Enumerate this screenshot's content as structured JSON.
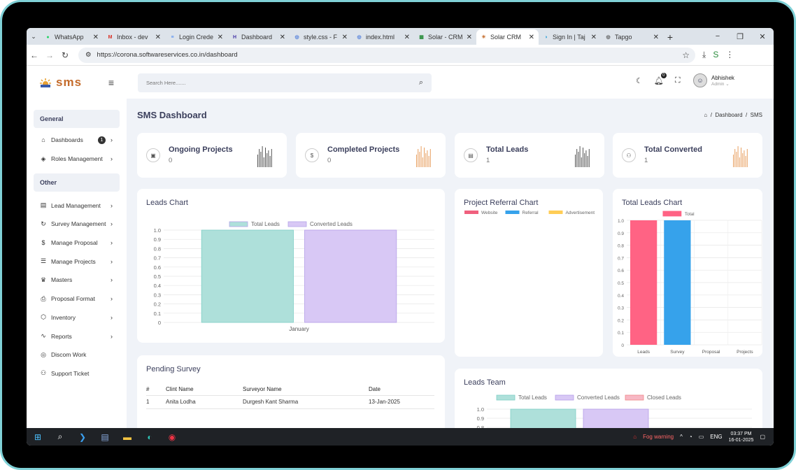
{
  "browser": {
    "tabs": [
      {
        "label": "WhatsApp",
        "fav": "whatsapp-icon",
        "color": "#25d366"
      },
      {
        "label": "Inbox - dev",
        "fav": "gmail-icon",
        "color": "#d93025"
      },
      {
        "label": "Login Crede",
        "fav": "docs-icon",
        "color": "#4285f4"
      },
      {
        "label": "Dashboard",
        "fav": "dashboard-icon",
        "color": "#4a3aa8"
      },
      {
        "label": "style.css - F",
        "fav": "globe-icon",
        "color": "#3b6fd8"
      },
      {
        "label": "index.html",
        "fav": "globe-icon",
        "color": "#3b6fd8"
      },
      {
        "label": "Solar - CRM",
        "fav": "solar-icon",
        "color": "#2a8c3c"
      },
      {
        "label": "Solar CRM",
        "fav": "solar-logo-icon",
        "color": "#c46b2b",
        "active": true
      },
      {
        "label": "Sign In | Taj",
        "fav": "signin-icon",
        "color": "#2a9fd8"
      },
      {
        "label": "Tapgo",
        "fav": "globe-icon",
        "color": "#444"
      }
    ],
    "url": "https://corona.softwareservices.co.in/dashboard"
  },
  "sidebar": {
    "logo": "sms",
    "general_label": "General",
    "general_items": [
      {
        "label": "Dashboards",
        "icon": "home-icon",
        "badge": "1"
      },
      {
        "label": "Roles Management",
        "icon": "cube-icon"
      }
    ],
    "other_label": "Other",
    "other_items": [
      {
        "label": "Lead Management",
        "icon": "file-icon",
        "chev": true
      },
      {
        "label": "Survey Management",
        "icon": "refresh-icon",
        "chev": true
      },
      {
        "label": "Manage Proposal",
        "icon": "dollar-icon",
        "chev": true
      },
      {
        "label": "Manage Projects",
        "icon": "server-icon",
        "chev": true
      },
      {
        "label": "Masters",
        "icon": "crown-icon",
        "chev": true
      },
      {
        "label": "Proposal Format",
        "icon": "printer-icon",
        "chev": true
      },
      {
        "label": "Inventory",
        "icon": "box-icon",
        "chev": true
      },
      {
        "label": "Reports",
        "icon": "activity-icon",
        "chev": true
      },
      {
        "label": "Discom Work",
        "icon": "target-icon",
        "chev": false
      },
      {
        "label": "Support Ticket",
        "icon": "users-icon",
        "chev": false
      }
    ]
  },
  "topbar": {
    "search_placeholder": "Search Here.......",
    "notif_count": "0",
    "user_name": "Abhishek",
    "user_role": "Admin"
  },
  "page": {
    "title": "SMS Dashboard",
    "crumb_1": "Dashboard",
    "crumb_2": "SMS"
  },
  "stats": [
    {
      "title": "Ongoing Projects",
      "value": "0",
      "icon": "calendar-icon",
      "bar_color": "#555"
    },
    {
      "title": "Completed Projects",
      "value": "0",
      "icon": "dollar-icon",
      "bar_color": "#e8a060"
    },
    {
      "title": "Total Leads",
      "value": "1",
      "icon": "file-icon",
      "bar_color": "#555"
    },
    {
      "title": "Total Converted",
      "value": "1",
      "icon": "users-icon",
      "bar_color": "#e8a060"
    }
  ],
  "charts": {
    "leads_title": "Leads Chart",
    "referral_title": "Project Referral Chart",
    "total_leads_title": "Total Leads Chart",
    "team_title": "Leads Team"
  },
  "chart_data": [
    {
      "type": "bar",
      "title": "Leads Chart",
      "categories": [
        "January"
      ],
      "series": [
        {
          "name": "Total Leads",
          "values": [
            1
          ],
          "color": "#aee0da"
        },
        {
          "name": "Converted Leads",
          "values": [
            1
          ],
          "color": "#d8c8f5"
        }
      ],
      "ylim": [
        0,
        1.0
      ],
      "yticks": [
        "0",
        "0.1",
        "0.2",
        "0.3",
        "0.4",
        "0.5",
        "0.6",
        "0.7",
        "0.8",
        "0.9",
        "1.0"
      ]
    },
    {
      "type": "pie",
      "title": "Project Referral Chart",
      "legend": [
        {
          "name": "Website",
          "color": "#f0607e"
        },
        {
          "name": "Referral",
          "color": "#36a2eb"
        },
        {
          "name": "Advertisement",
          "color": "#ffcd56"
        }
      ],
      "values": []
    },
    {
      "type": "bar",
      "title": "Total Leads Chart",
      "categories": [
        "Leads",
        "Survey",
        "Proposal",
        "Projects"
      ],
      "series": [
        {
          "name": "Total",
          "values": [
            1,
            1,
            0,
            0
          ],
          "colors": [
            "#ff6384",
            "#36a2eb",
            "#ffcd56",
            "#4bc0c0"
          ]
        }
      ],
      "ylim": [
        0,
        1.0
      ],
      "yticks": [
        "0",
        "0.1",
        "0.2",
        "0.3",
        "0.4",
        "0.5",
        "0.6",
        "0.7",
        "0.8",
        "0.9",
        "1.0"
      ]
    },
    {
      "type": "bar",
      "title": "Leads Team",
      "series": [
        {
          "name": "Total Leads",
          "values": [
            1
          ],
          "color": "#aee0da"
        },
        {
          "name": "Converted Leads",
          "values": [
            1
          ],
          "color": "#d8c8f5"
        },
        {
          "name": "Closed Leads",
          "values": [
            0
          ],
          "color": "#f7b8c4"
        }
      ],
      "ylim": [
        0,
        1.0
      ],
      "yticks": [
        "1.0",
        "0.9",
        "0.8"
      ]
    }
  ],
  "pending": {
    "title": "Pending Survey",
    "headers": [
      "#",
      "Clint Name",
      "Surveyor Name",
      "Date"
    ],
    "rows": [
      [
        "1",
        "Anita Lodha",
        "Durgesh Kant Sharma",
        "13-Jan-2025"
      ]
    ]
  },
  "taskbar": {
    "weather": "Fog warning",
    "lang": "ENG",
    "time": "03:37 PM",
    "date": "16-01-2025"
  }
}
